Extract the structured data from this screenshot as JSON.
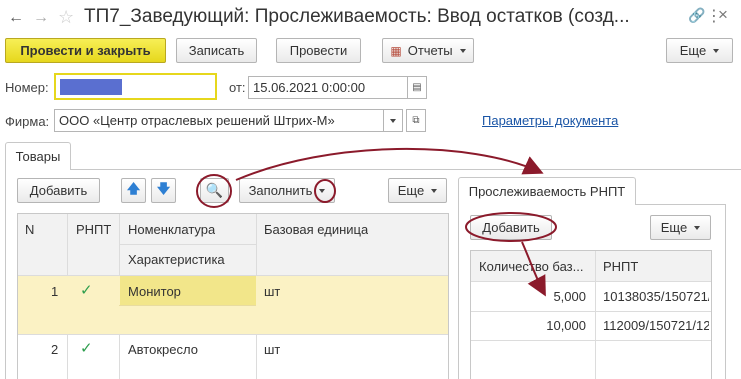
{
  "window": {
    "title": "ТП7_Заведующий: Прослеживаемость: Ввод остатков (созд..."
  },
  "toolbar": {
    "post_close": "Провести и закрыть",
    "save": "Записать",
    "post": "Провести",
    "reports": "Отчеты",
    "more": "Еще"
  },
  "form": {
    "number_label": "Номер:",
    "number_value": "",
    "from_label": "от:",
    "date_value": "15.06.2021  0:00:00",
    "company_label": "Фирма:",
    "company_value": "ООО «Центр отраслевых решений Штрих-М»",
    "params_link": "Параметры документа"
  },
  "tabs": {
    "goods": "Товары"
  },
  "goods": {
    "add": "Добавить",
    "fill": "Заполнить",
    "more": "Еще",
    "columns": {
      "n": "N",
      "rnpt": "РНПТ",
      "nomenclature": "Номенклатура",
      "characteristic": "Характеристика",
      "unit": "Базовая единица"
    },
    "rows": [
      {
        "n": "1",
        "rnpt_checked": true,
        "name": "Монитор",
        "unit": "шт"
      },
      {
        "n": "2",
        "rnpt_checked": true,
        "name": "Автокресло",
        "unit": "шт"
      }
    ]
  },
  "trace": {
    "tab": "Прослеживаемость РНПТ",
    "add": "Добавить",
    "more": "Еще",
    "columns": {
      "qty": "Количество баз...",
      "rnpt": "РНПТ"
    },
    "rows": [
      {
        "qty": "5,000",
        "rnpt": "10138035/150721/..."
      },
      {
        "qty": "10,000",
        "rnpt": "112009/150721/12..."
      }
    ]
  },
  "colors": {
    "accent_yellow": "#f2e64b",
    "selected_row": "#fbf2c4",
    "annotation": "#8b1a2b",
    "link": "#1a55a6",
    "number_fill": "#5a6fd0"
  }
}
